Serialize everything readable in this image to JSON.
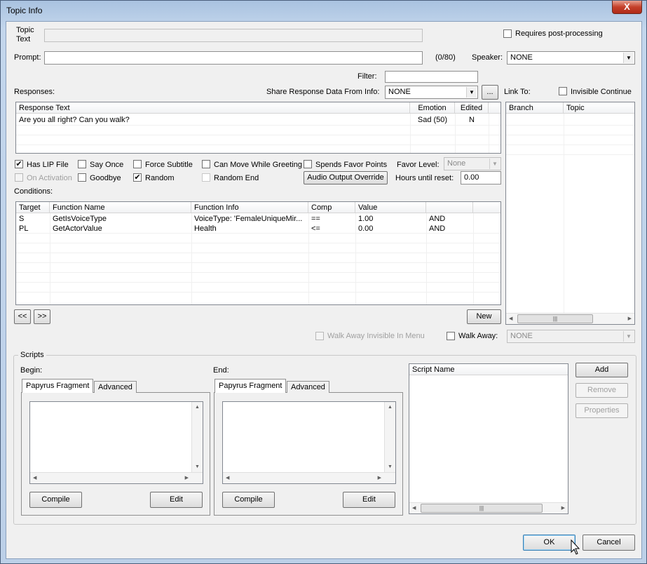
{
  "window": {
    "title": "Topic Info",
    "close_label": "X"
  },
  "topic": {
    "topic_text_label": "Topic Text",
    "topic_text_value": "",
    "requires_post_label": "Requires post-processing",
    "prompt_label": "Prompt:",
    "prompt_value": "",
    "prompt_counter": "(0/80)",
    "speaker_label": "Speaker:",
    "speaker_value": "NONE",
    "filter_label": "Filter:",
    "filter_value": ""
  },
  "responses": {
    "label": "Responses:",
    "share_label": "Share Response Data From Info:",
    "share_value": "NONE",
    "share_more": "...",
    "headers": [
      "Response Text",
      "Emotion",
      "Edited"
    ],
    "rows": [
      {
        "text": "Are you all right? Can you walk?",
        "emotion": "Sad (50)",
        "edited": "N"
      }
    ]
  },
  "link": {
    "label": "Link To:",
    "invisible_continue_label": "Invisible Continue",
    "headers": [
      "Branch",
      "Topic"
    ],
    "hscroll_thumb": "|||"
  },
  "flags": {
    "has_lip": "Has LIP File",
    "say_once": "Say Once",
    "force_subtitle": "Force Subtitle",
    "can_move": "Can Move While Greeting",
    "spends_favor": "Spends Favor Points",
    "favor_level_label": "Favor Level:",
    "favor_level_value": "None",
    "on_activation": "On Activation",
    "goodbye": "Goodbye",
    "random": "Random",
    "random_end": "Random End",
    "audio_override": "Audio Output Override",
    "hours_label": "Hours until reset:",
    "hours_value": "0.00",
    "check_mark": "✔"
  },
  "conditions": {
    "label": "Conditions:",
    "headers": [
      "Target",
      "Function Name",
      "Function Info",
      "Comp",
      "Value",
      "",
      ""
    ],
    "rows": [
      {
        "target": "S",
        "func": "GetIsVoiceType",
        "info": "VoiceType: 'FemaleUniqueMir...",
        "comp": "==",
        "value": "1.00",
        "op": "AND"
      },
      {
        "target": "PL",
        "func": "GetActorValue",
        "info": "Health",
        "comp": "<=",
        "value": "0.00",
        "op": "AND"
      }
    ],
    "prev_label": "<<",
    "next_label": ">>",
    "new_label": "New"
  },
  "walk": {
    "walk_invisible_label": "Walk Away Invisible In Menu",
    "walk_away_label": "Walk Away:",
    "walk_away_value": "NONE"
  },
  "scripts": {
    "group_label": "Scripts",
    "begin_label": "Begin:",
    "end_label": "End:",
    "tab_papyrus": "Papyrus Fragment",
    "tab_advanced": "Advanced",
    "compile_label": "Compile",
    "edit_label": "Edit",
    "script_name_header": "Script Name",
    "add_label": "Add",
    "remove_label": "Remove",
    "properties_label": "Properties"
  },
  "footer": {
    "ok_label": "OK",
    "cancel_label": "Cancel"
  }
}
